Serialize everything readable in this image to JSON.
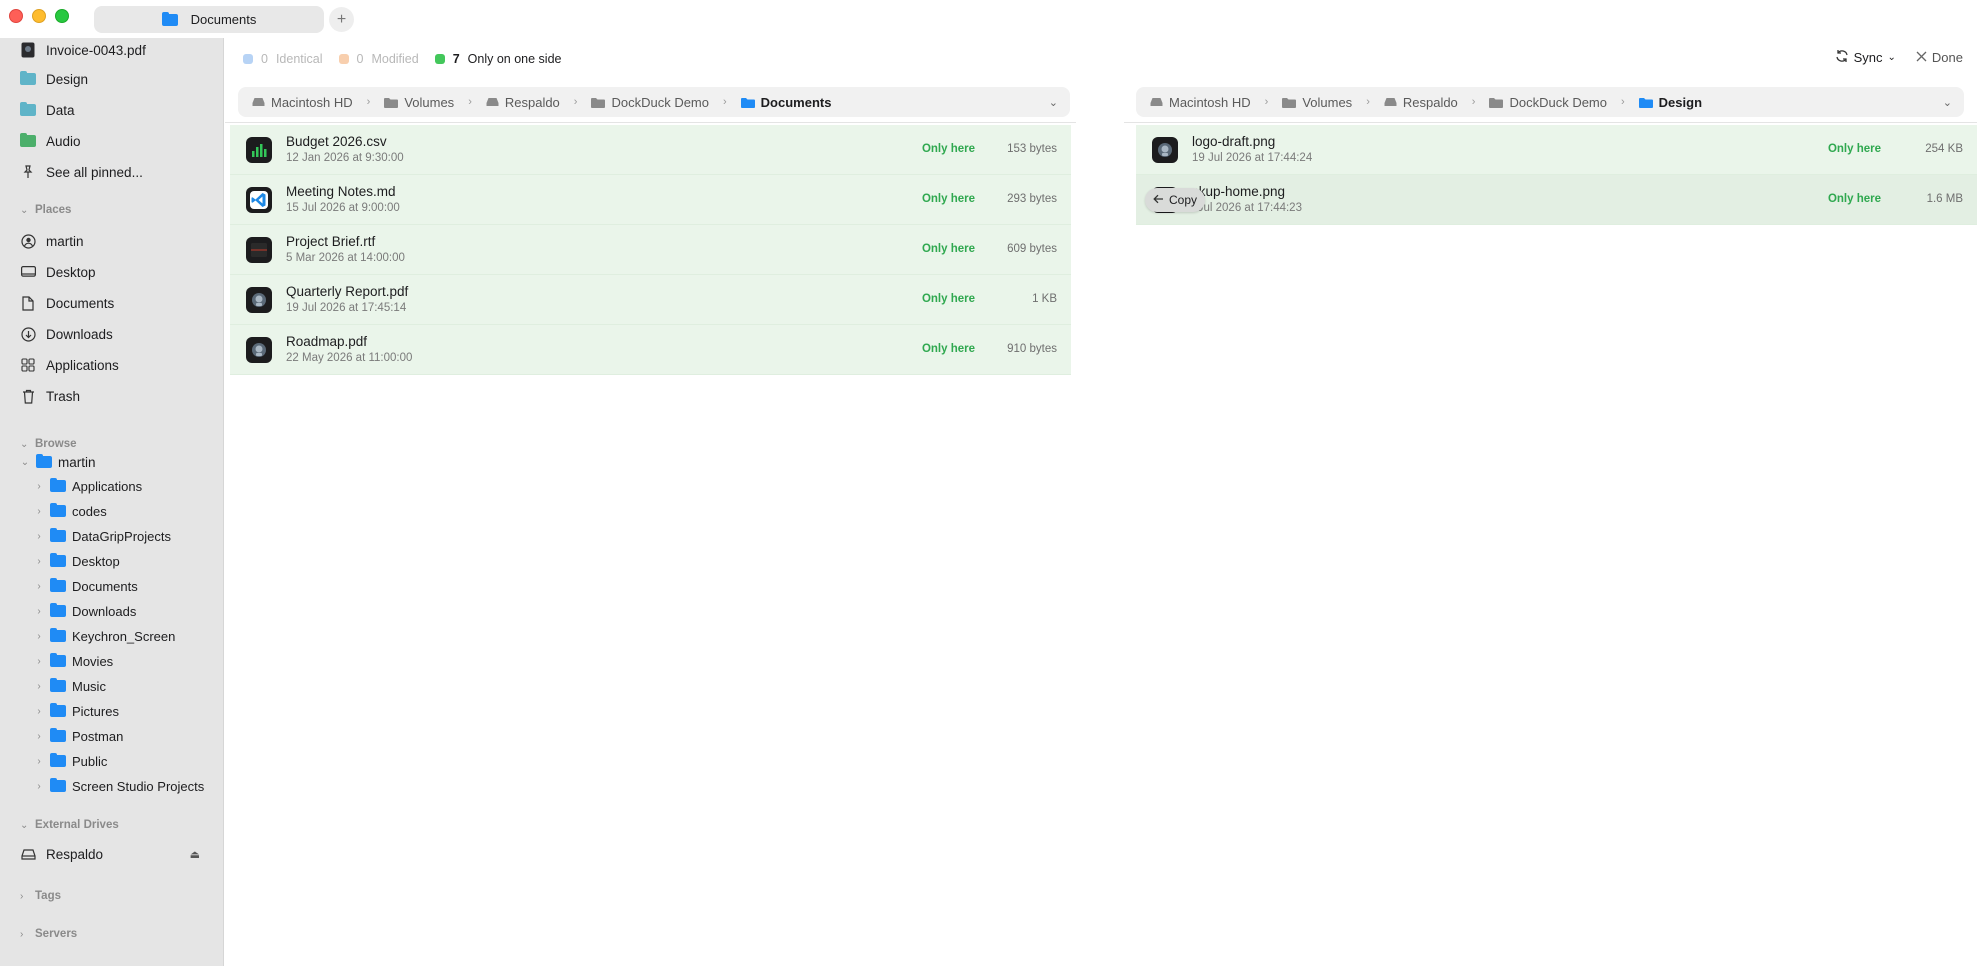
{
  "window": {
    "tab_title": "Documents",
    "tab_add": "+"
  },
  "sidebar": {
    "pinned": [
      {
        "label": "Invoice-0043.pdf",
        "icon": "pdf-file-icon"
      },
      {
        "label": "Design",
        "icon": "folder-icon"
      },
      {
        "label": "Data",
        "icon": "folder-icon"
      },
      {
        "label": "Audio",
        "icon": "folder-icon"
      },
      {
        "label": "See all pinned...",
        "icon": "pin-icon"
      }
    ],
    "places_title": "Places",
    "places": [
      {
        "label": "martin",
        "icon": "user-icon"
      },
      {
        "label": "Desktop",
        "icon": "desktop-icon"
      },
      {
        "label": "Documents",
        "icon": "document-icon"
      },
      {
        "label": "Downloads",
        "icon": "download-icon"
      },
      {
        "label": "Applications",
        "icon": "apps-grid-icon"
      },
      {
        "label": "Trash",
        "icon": "trash-icon"
      }
    ],
    "browse_title": "Browse",
    "browse_root": "martin",
    "browse_children": [
      "Applications",
      "codes",
      "DataGripProjects",
      "Desktop",
      "Documents",
      "Downloads",
      "Keychron_Screen",
      "Movies",
      "Music",
      "Pictures",
      "Postman",
      "Public",
      "Screen Studio Projects"
    ],
    "external_title": "External Drives",
    "external": [
      {
        "label": "Respaldo",
        "icon": "drive-icon"
      }
    ],
    "tags_title": "Tags",
    "servers_title": "Servers"
  },
  "legend": {
    "identical": {
      "count": "0",
      "label": "Identical",
      "color": "#b7d3f5"
    },
    "modified": {
      "count": "0",
      "label": "Modified",
      "color": "#f8cfae"
    },
    "one_side": {
      "count": "7",
      "label": "Only on one side",
      "color": "#43c75b"
    }
  },
  "toolbar": {
    "sync_label": "Sync",
    "done_label": "Done"
  },
  "left_pane": {
    "path": [
      "Macintosh HD",
      "Volumes",
      "Respaldo",
      "DockDuck Demo",
      "Documents"
    ],
    "files": [
      {
        "name": "Budget 2026.csv",
        "date": "12 Jan 2026 at 9:30:00",
        "status": "Only here",
        "size": "153 bytes",
        "icon": "numbers-chart-icon"
      },
      {
        "name": "Meeting Notes.md",
        "date": "15 Jul 2026 at 9:00:00",
        "status": "Only here",
        "size": "293 bytes",
        "icon": "vscode-icon"
      },
      {
        "name": "Project Brief.rtf",
        "date": "5 Mar 2026 at 14:00:00",
        "status": "Only here",
        "size": "609 bytes",
        "icon": "rtf-doc-icon"
      },
      {
        "name": "Quarterly Report.pdf",
        "date": "19 Jul 2026 at 17:45:14",
        "status": "Only here",
        "size": "1 KB",
        "icon": "preview-icon"
      },
      {
        "name": "Roadmap.pdf",
        "date": "22 May 2026 at 11:00:00",
        "status": "Only here",
        "size": "910 bytes",
        "icon": "preview-icon"
      }
    ]
  },
  "right_pane": {
    "path": [
      "Macintosh HD",
      "Volumes",
      "Respaldo",
      "DockDuck Demo",
      "Design"
    ],
    "files": [
      {
        "name": "logo-draft.png",
        "date": "19 Jul 2026 at 17:44:24",
        "status": "Only here",
        "size": "254 KB",
        "icon": "preview-icon"
      },
      {
        "name": "ckup-home.png",
        "date": "l Jul 2026 at 17:44:23",
        "status": "Only here",
        "size": "1.6 MB",
        "icon": "preview-icon"
      }
    ],
    "copy_label": "Copy"
  }
}
